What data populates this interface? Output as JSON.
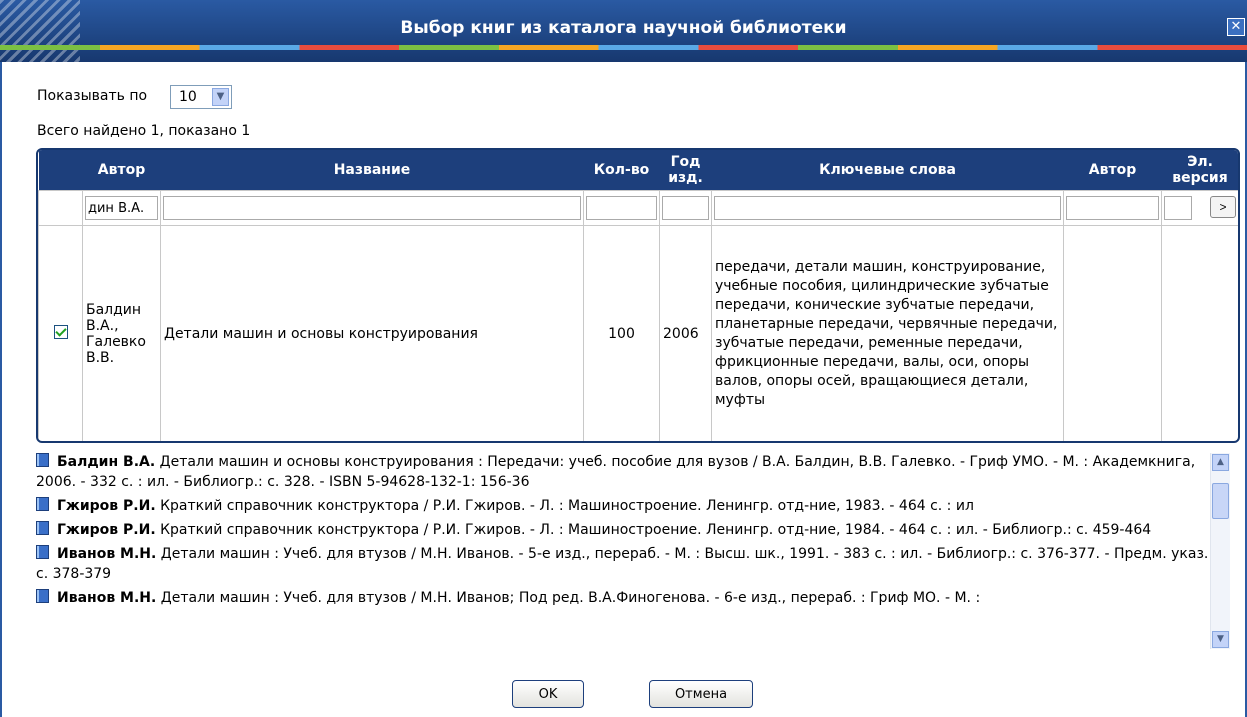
{
  "window": {
    "title": "Выбор книг из каталога научной библиотеки",
    "close": "✕"
  },
  "paging": {
    "label": "Показывать по",
    "value": "10",
    "summary": "Всего найдено 1, показано 1"
  },
  "table": {
    "headers": [
      "Автор",
      "Название",
      "Кол-во",
      "Год изд.",
      "Ключевые слова",
      "Автор",
      "Эл. версия"
    ],
    "filter": {
      "author": "дин В.А.",
      "go": ">"
    },
    "row": {
      "author": "Балдин В.А., Галевко В.В.",
      "title": "Детали машин и основы конструирования",
      "qty": "100",
      "year": "2006",
      "keywords": "передачи, детали машин, конструирование, учебные пособия, цилиндрические зубчатые передачи, конические зубчатые передачи, планетарные передачи, червячные передачи, зубчатые передачи, ременные передачи, фрикционные передачи, валы, оси, опоры валов, опоры осей, вращающиеся детали, муфты"
    }
  },
  "references": [
    {
      "author": "Балдин В.А.",
      "text": " Детали машин и основы конструирования : Передачи: учеб. пособие для вузов / В.А. Балдин, В.В. Галевко. - Гриф УМО. - М. : Академкнига, 2006. - 332 с. : ил. - Библиогр.: с. 328. - ISBN 5-94628-132-1: 156-36"
    },
    {
      "author": "Гжиров Р.И.",
      "text": " Краткий справочник конструктора / Р.И. Гжиров. - Л. : Машиностроение. Ленингр. отд-ние, 1983. - 464 с. : ил"
    },
    {
      "author": "Гжиров Р.И.",
      "text": " Краткий справочник конструктора / Р.И. Гжиров. - Л. : Машиностроение. Ленингр. отд-ние, 1984. - 464 с. : ил. - Библиогр.: с. 459-464"
    },
    {
      "author": "Иванов М.Н.",
      "text": " Детали машин : Учеб. для втузов / М.Н. Иванов. - 5-е изд., перераб. - М. : Высш. шк., 1991. - 383 с. : ил. - Библиогр.: с. 376-377. - Предм. указ.: с. 378-379"
    },
    {
      "author": "Иванов М.Н.",
      "text": " Детали машин : Учеб. для втузов / М.Н. Иванов; Под ред. В.А.Финогенова. - 6-е изд., перераб. : Гриф МО. - М. :"
    }
  ],
  "buttons": {
    "ok": "OK",
    "cancel": "Отмена"
  },
  "colors": {
    "titlebar": "#1d3f7c",
    "border": "#17386f"
  }
}
